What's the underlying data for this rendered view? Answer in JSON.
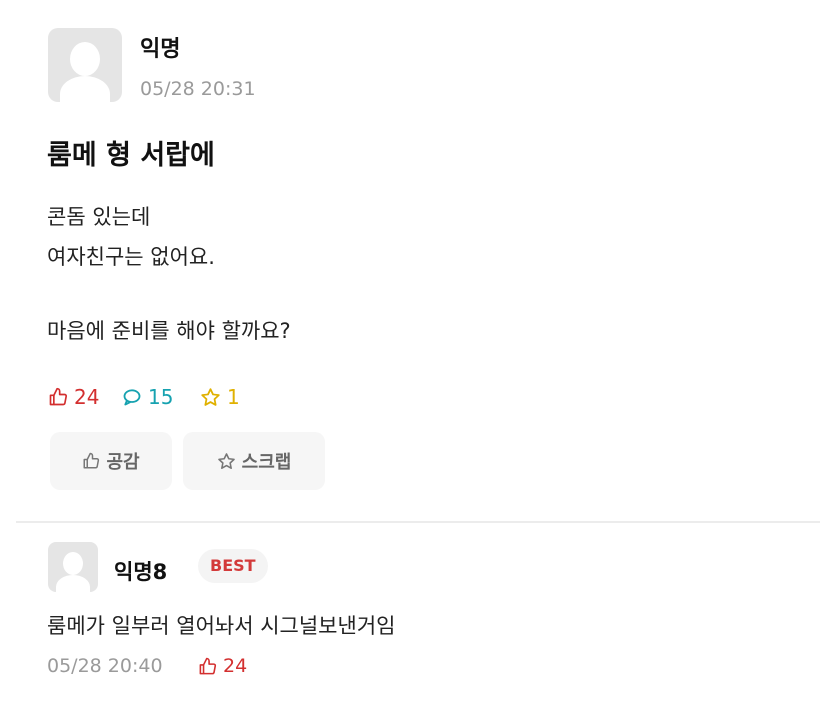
{
  "post": {
    "author": "익명",
    "time": "05/28 20:31",
    "title": "룸메 형 서랍에",
    "body_lines": [
      "콘돔 있는데",
      "여자친구는 없어요.",
      "마음에 준비를 해야 할까요?"
    ],
    "stats": {
      "likes": "24",
      "comments": "15",
      "scraps": "1"
    },
    "actions": {
      "like_label": "공감",
      "scrap_label": "스크랩"
    }
  },
  "comment": {
    "author": "익명8",
    "badge": "BEST",
    "text": "룸메가  일부러 열어놔서 시그널보낸거임",
    "time": "05/28 20:40",
    "likes": "24"
  },
  "icons": {
    "like": "thumbs-up-icon",
    "comment": "speech-bubble-icon",
    "scrap": "star-icon",
    "avatar": "default-avatar-icon"
  },
  "colors": {
    "like": "#d32f2f",
    "comment": "#16a2b0",
    "scrap": "#e0b100",
    "badge_text": "#d33a3a",
    "meta_text": "#9a9a9a"
  }
}
